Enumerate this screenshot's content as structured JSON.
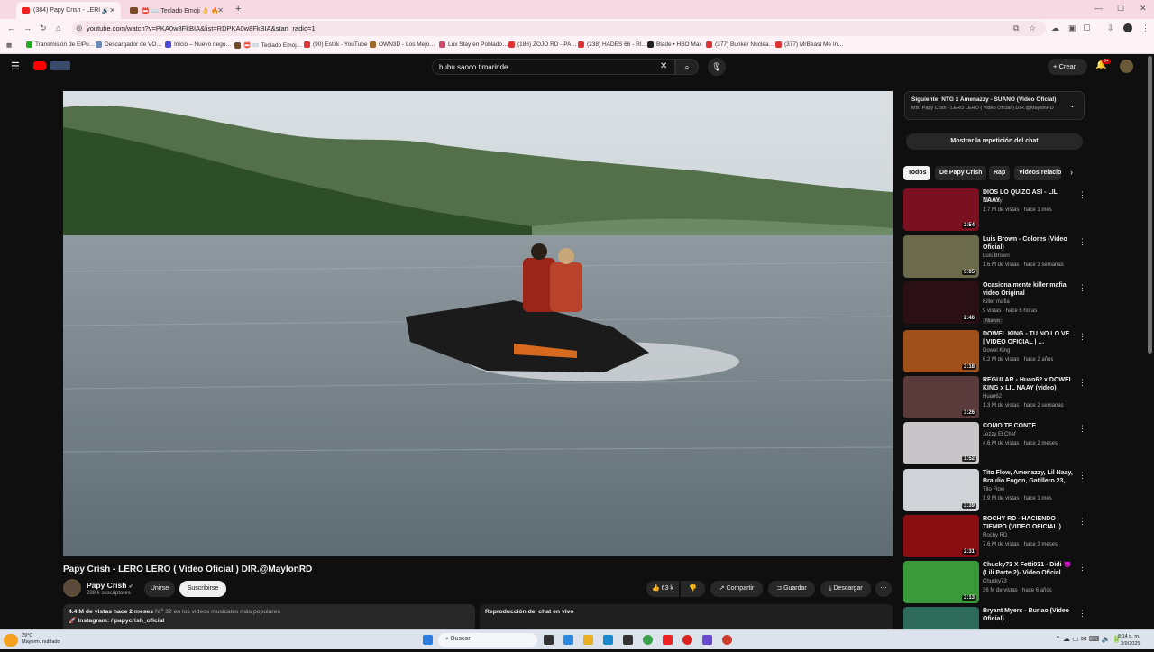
{
  "browser": {
    "tabs": [
      {
        "label": "(384) Papy Crish - LERO LER…",
        "active": true
      },
      {
        "label": "📛 ⌨️ Teclado Emoji 👌 🔥 37…",
        "active": false
      }
    ],
    "url": "youtube.com/watch?v=PKA0w8FkBIA&list=RDPKA0w8FkBIA&start_radio=1",
    "bookmarks": [
      "Transmisión de ElPu…",
      "Descargador de VO…",
      "Inicio – Nuevo nego…",
      "📛 ⌨️ Teclado Emoj…",
      "(90) Esttik - YouTube",
      "OWN3D - Los Mejo…",
      "Lux Stay en Poblado…",
      "(186) ZOJO RD - PA…",
      "(238) HADES 66 - RI…",
      "Blade • HBO Max",
      "(377) Bunker Nuclea…",
      "(377) MrBeast Me In…"
    ]
  },
  "youtube": {
    "search_value": "bubu saoco timarinde",
    "create_label": "Crear",
    "notif_count": "9+"
  },
  "video": {
    "title": "Papy Crish - LERO LERO ( Video Oficial ) DIR.@MaylonRD",
    "channel": "Papy Crish",
    "subscribers": "288 k suscriptores",
    "join_label": "Unirse",
    "subscribe_label": "Suscribirse",
    "likes": "63 k",
    "share_label": "Compartir",
    "save_label": "Guardar",
    "download_label": "Descargar",
    "description_stats": "4.4 M de vistas  hace 2 meses",
    "description_rank": "N.º 32 en los videos musicales más populares",
    "description_line2": "🚀 Instagram:   / papycrish_oficial",
    "chat_replay_label": "Reproducción del chat en vivo"
  },
  "sidebar": {
    "next_label": "Siguiente: NTG x Amenazzy - SUANO (Video Oficial)",
    "mix_label": "Mix: Papy Crish - LERO LERO ( Video Oficial ) DIR.@MaylonRD",
    "show_chat_label": "Mostrar la repetición del chat",
    "chips": [
      "Todos",
      "De Papy Crish",
      "Rap",
      "Videos relacio"
    ],
    "recommendations": [
      {
        "title": "DIOS LO QUIZO ASÍ - LIL NAAY",
        "channel": "Lil Naay",
        "meta": "1.7 M de vistas · hace 1 mes",
        "duration": "2:54",
        "color": "#7a1020"
      },
      {
        "title": "Luis Brown - Colores (Video Oficial)",
        "channel": "Luis Brown",
        "meta": "1.6 M de vistas · hace 3 semanas",
        "duration": "3:05",
        "color": "#6b6a4a"
      },
      {
        "title": "Ocasionalmente killer mafia video Original",
        "channel": "Killer mafia",
        "meta": "9 vistas · hace 6 horas",
        "duration": "2:46",
        "color": "#2a0f14",
        "badge": "Nuevo"
      },
      {
        "title": "DOWEL KING - TU NO LO VE | VIDEO OFICIAL | …",
        "channel": "Dowel King",
        "meta": "6.2 M de vistas · hace 2 años",
        "duration": "3:18",
        "color": "#a0501a"
      },
      {
        "title": "REGULAR - Huan62 x DOWEL KING x LIL NAAY (video)",
        "channel": "Huan62",
        "meta": "1.3 M de vistas · hace 2 semanas",
        "duration": "3:26",
        "color": "#5a3a3a"
      },
      {
        "title": "COMO TE CONTE",
        "channel": "Jezzy El Chef",
        "meta": "4.6 M de vistas · hace 2 meses",
        "duration": "1:52",
        "color": "#c9c4c8"
      },
      {
        "title": "Tito Flow, Amenazzy, Lil Naay, Braulio Fogon, Gatillero 23, …",
        "channel": "Tito Flow",
        "meta": "1.9 M de vistas · hace 1 mes",
        "duration": "3:39",
        "color": "#cfd2d6"
      },
      {
        "title": "ROCHY RD - HACIENDO TIEMPO (VIDEO OFICIAL )",
        "channel": "Rochy RD",
        "meta": "7.6 M de vistas · hace 3 meses",
        "duration": "2:31",
        "color": "#8a0d12"
      },
      {
        "title": "Chucky73 X Fetti031 - Didi 👿 (Lili Parte 2)- Video Oficial",
        "channel": "Chucky73",
        "meta": "36 M de vistas · hace 6 años",
        "duration": "3:13",
        "color": "#3a9a3a"
      },
      {
        "title": "Bryant Myers - Burlao (Video Oficial)",
        "channel": "",
        "meta": "",
        "duration": "",
        "color": "#2d6a5a"
      }
    ]
  },
  "taskbar": {
    "search_placeholder": "Buscar",
    "weather_temp": "29°C",
    "weather_desc": "Mayorm. nublado",
    "time": "8:14 p. m.",
    "date": "3/9/2025"
  }
}
